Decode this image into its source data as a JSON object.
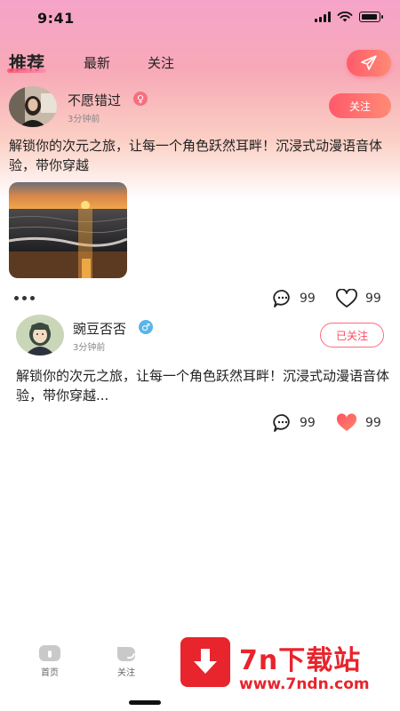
{
  "status_bar": {
    "time": "9:41"
  },
  "tabs": [
    {
      "label": "推荐",
      "active": true
    },
    {
      "label": "最新",
      "active": false
    },
    {
      "label": "关注",
      "active": false
    }
  ],
  "posts": [
    {
      "username": "不愿错过",
      "gender": "female",
      "time": "3分钟前",
      "follow_label": "关注",
      "text": "解锁你的次元之旅，让每一个角色跃然耳畔！沉浸式动漫语音体验，带你穿越",
      "comments": "99",
      "likes": "99",
      "liked": false
    },
    {
      "username": "豌豆否否",
      "gender": "male",
      "time": "3分钟前",
      "follow_label": "已关注",
      "text": "解锁你的次元之旅，让每一个角色跃然耳畔！沉浸式动漫语音体验，带你穿越...",
      "comments": "99",
      "likes": "99",
      "liked": true
    }
  ],
  "bottom_nav": [
    {
      "label": "首页"
    },
    {
      "label": "关注"
    }
  ],
  "watermark": {
    "title": "7n下载站",
    "url": "www.7ndn.com"
  },
  "colors": {
    "accent": "#ff5a6b",
    "female": "#f56f7f",
    "male": "#5ab4e8",
    "watermark": "#e8242c"
  }
}
